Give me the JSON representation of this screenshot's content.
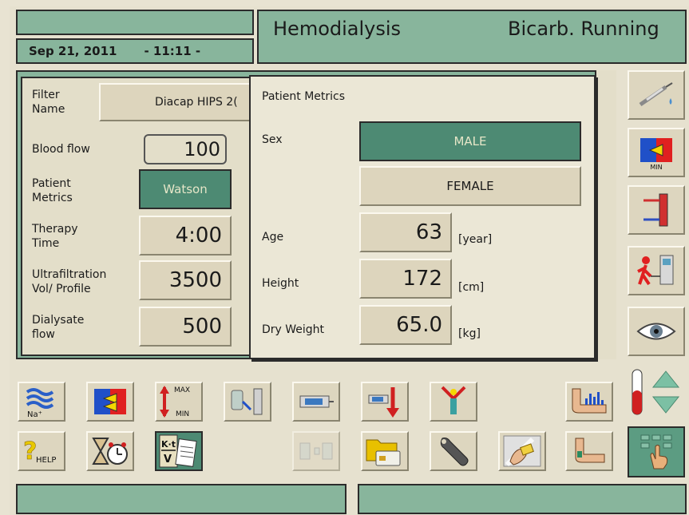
{
  "header": {
    "date": "Sep 21, 2011",
    "time": "- 11:11 -",
    "mode": "Hemodialysis",
    "status": "Bicarb. Running"
  },
  "params": {
    "filter_label": "Filter\nName",
    "filter_value": "Diacap HIPS 2(",
    "blood_flow_label": "Blood flow",
    "blood_flow_value": "100",
    "patient_metrics_label": "Patient\nMetrics",
    "patient_metrics_value": "Watson",
    "therapy_label": "Therapy\nTime",
    "therapy_value": "4:00",
    "uf_label": "Ultrafiltration\nVol/ Profile",
    "uf_value": "3500",
    "dialysate_label": "Dialysate\nflow",
    "dialysate_value": "500"
  },
  "popup": {
    "title": "Patient Metrics",
    "sex_label": "Sex",
    "male": "MALE",
    "female": "FEMALE",
    "age_label": "Age",
    "age_value": "63",
    "age_unit": "[year]",
    "height_label": "Height",
    "height_value": "172",
    "height_unit": "[cm]",
    "weight_label": "Dry Weight",
    "weight_value": "65.0",
    "weight_unit": "[kg]"
  },
  "icons": {
    "sodium_label": "Na⁺",
    "max_label": "MAX",
    "min_label": "MIN",
    "help_label": "HELP",
    "kt_label": "K·t",
    "v_label": "V",
    "min_side_label": "MIN"
  },
  "colors": {
    "green": "#88b59c",
    "selected": "#4d8a73",
    "beige": "#ddd7c1"
  }
}
